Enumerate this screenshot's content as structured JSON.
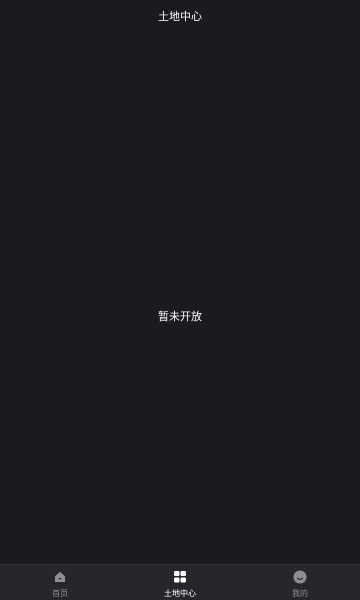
{
  "header": {
    "title": "土地中心"
  },
  "main": {
    "empty_text": "暂未开放"
  },
  "tabbar": {
    "active_index": 1,
    "items": [
      {
        "label": "首页",
        "icon": "home-icon",
        "color": "#8e8f95"
      },
      {
        "label": "土地中心",
        "icon": "land-center-icon",
        "color": "#ffffff"
      },
      {
        "label": "我的",
        "icon": "profile-icon",
        "color": "#8e8f95"
      }
    ]
  },
  "colors": {
    "background": "#1b1b1f",
    "tabbar_background": "#26272b",
    "active": "#ffffff",
    "inactive": "#8e8f95"
  }
}
